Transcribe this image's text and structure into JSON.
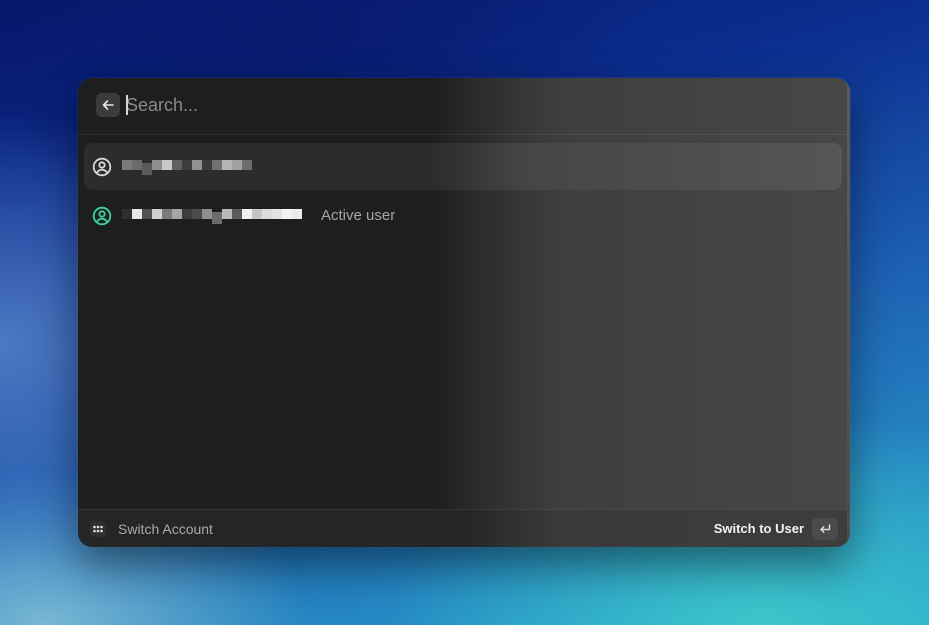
{
  "search": {
    "placeholder": "Search..."
  },
  "icons": {
    "back": "arrow-left-icon",
    "user": "person-circle-icon",
    "active_user": "person-circle-icon",
    "app": "dots-grid-icon",
    "enter": "return-key-icon"
  },
  "list": {
    "items": [
      {
        "name_redacted": true,
        "accessory": "",
        "selected": true
      },
      {
        "name_redacted": true,
        "accessory": "Active user",
        "selected": false
      }
    ]
  },
  "footer": {
    "title": "Switch Account",
    "primary_action": "Switch to User"
  },
  "colors": {
    "active_user_icon": "#3fd39a",
    "user_icon": "#d8d8d8"
  }
}
